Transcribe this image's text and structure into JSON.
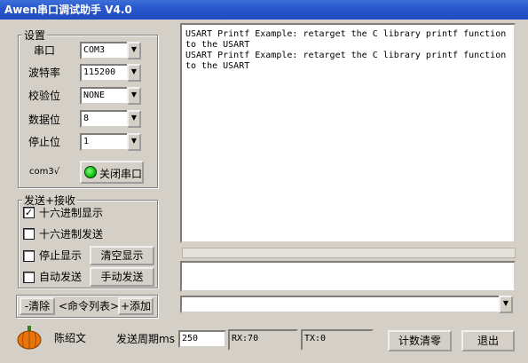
{
  "window": {
    "title": "Awen串口调试助手 V4.0"
  },
  "settings": {
    "group_title": "设置",
    "port_label": "串口",
    "port_value": "COM3",
    "baud_label": "波特率",
    "baud_value": "115200",
    "parity_label": "校验位",
    "parity_value": "NONE",
    "databits_label": "数据位",
    "databits_value": "8",
    "stopbits_label": "停止位",
    "stopbits_value": "1",
    "port_status": "com3√",
    "close_port_label": "关闭串口"
  },
  "sendrecv": {
    "group_title": "发送+接收",
    "hex_display_label": "十六进制显示",
    "hex_display_checked": true,
    "hex_send_label": "十六进制发送",
    "hex_send_checked": false,
    "stop_display_label": "停止显示",
    "stop_display_checked": false,
    "auto_send_label": "自动发送",
    "auto_send_checked": false,
    "clear_display_label": "清空显示",
    "manual_send_label": "手动发送"
  },
  "cmdlist": {
    "remove_label": "-清除",
    "list_label": "<命令列表>",
    "add_label": "+添加"
  },
  "receive": {
    "lines": [
      "USART Printf Example: retarget the C library printf function",
      "to the USART",
      "USART Printf Example: retarget the C library printf function",
      "to the USART"
    ]
  },
  "bottom": {
    "author": "陈绍文",
    "period_label": "发送周期ms",
    "period_value": "250",
    "rx": "RX:70",
    "tx": "TX:0",
    "count_clear_label": "计数清零",
    "exit_label": "退出"
  },
  "icons": {
    "logo": "pumpkin-icon",
    "led": "green-led-icon"
  },
  "colors": {
    "title_bar": "#2a58cc",
    "window_bg": "#d4d0c8",
    "led": "#00b000",
    "pumpkin": "#e8740c"
  }
}
